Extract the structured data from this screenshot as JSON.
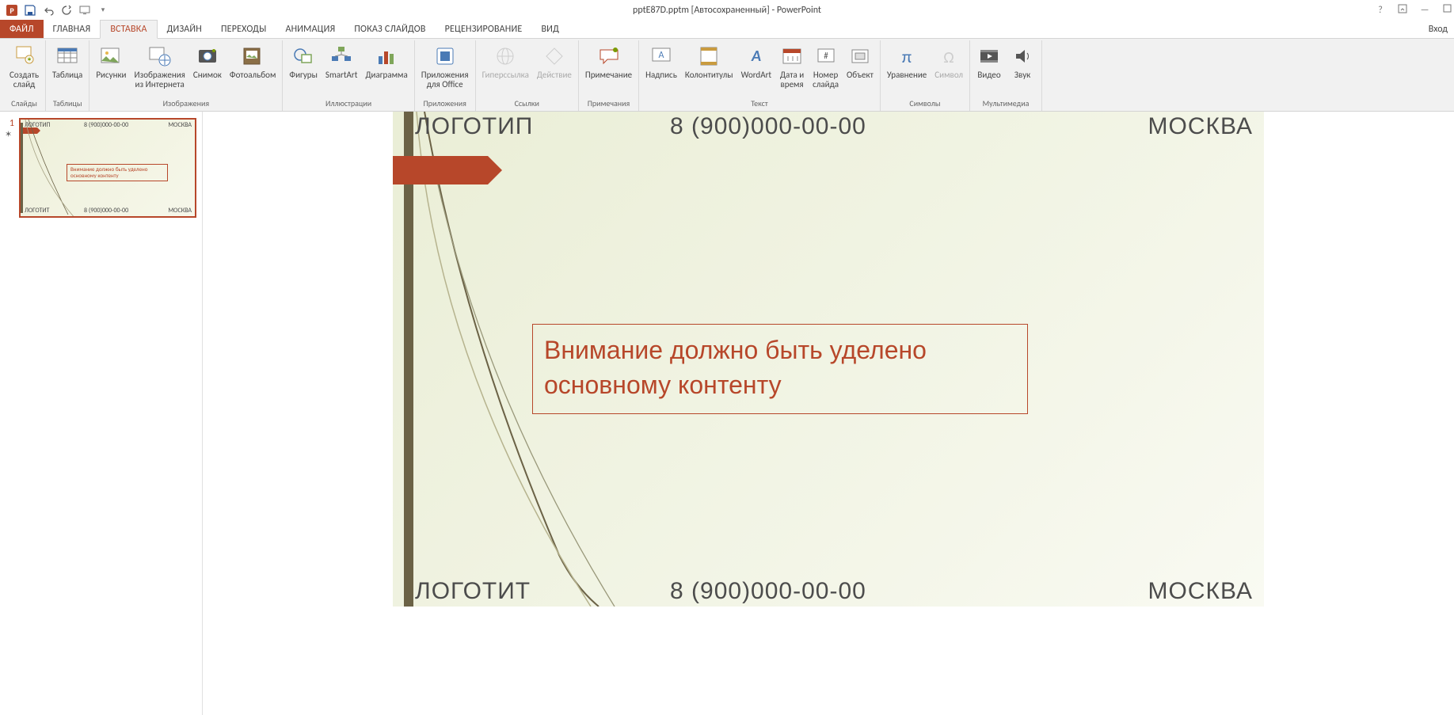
{
  "title": "pptE87D.pptm [Автосохраненный] - PowerPoint",
  "signin": "Вход",
  "tabs": {
    "file": "ФАЙЛ",
    "home": "ГЛАВНАЯ",
    "insert": "ВСТАВКА",
    "design": "ДИЗАЙН",
    "transitions": "ПЕРЕХОДЫ",
    "animations": "АНИМАЦИЯ",
    "slideshow": "ПОКАЗ СЛАЙДОВ",
    "review": "РЕЦЕНЗИРОВАНИЕ",
    "view": "ВИД"
  },
  "ribbon": {
    "groups": {
      "slides": {
        "label": "Слайды",
        "new_slide": "Создать\nслайд"
      },
      "tables": {
        "label": "Таблицы",
        "table": "Таблица"
      },
      "images": {
        "label": "Изображения",
        "pictures": "Рисунки",
        "online_pics": "Изображения\nиз Интернета",
        "screenshot": "Снимок",
        "album": "Фотоальбом"
      },
      "illustrations": {
        "label": "Иллюстрации",
        "shapes": "Фигуры",
        "smartart": "SmartArt",
        "chart": "Диаграмма"
      },
      "apps": {
        "label": "Приложения",
        "office_apps": "Приложения\nдля Office"
      },
      "links": {
        "label": "Ссылки",
        "hyperlink": "Гиперссылка",
        "action": "Действие"
      },
      "comments": {
        "label": "Примечания",
        "comment": "Примечание"
      },
      "text": {
        "label": "Текст",
        "textbox": "Надпись",
        "header_footer": "Колонтитулы",
        "wordart": "WordArt",
        "datetime": "Дата и\nвремя",
        "slidenum": "Номер\nслайда",
        "object": "Объект"
      },
      "symbols": {
        "label": "Символы",
        "equation": "Уравнение",
        "symbol": "Символ"
      },
      "media": {
        "label": "Мультимедиа",
        "video": "Видео",
        "audio": "Звук"
      }
    }
  },
  "thumb": {
    "num": "1"
  },
  "slide": {
    "header": {
      "logo": "ЛОГОТИП",
      "phone": "8 (900)000-00-00",
      "city": "МОСКВА"
    },
    "content": "Внимание должно быть уделено основному контенту",
    "footer": {
      "logo": "ЛОГОТИТ",
      "phone": "8 (900)000-00-00",
      "city": "МОСКВА"
    }
  }
}
